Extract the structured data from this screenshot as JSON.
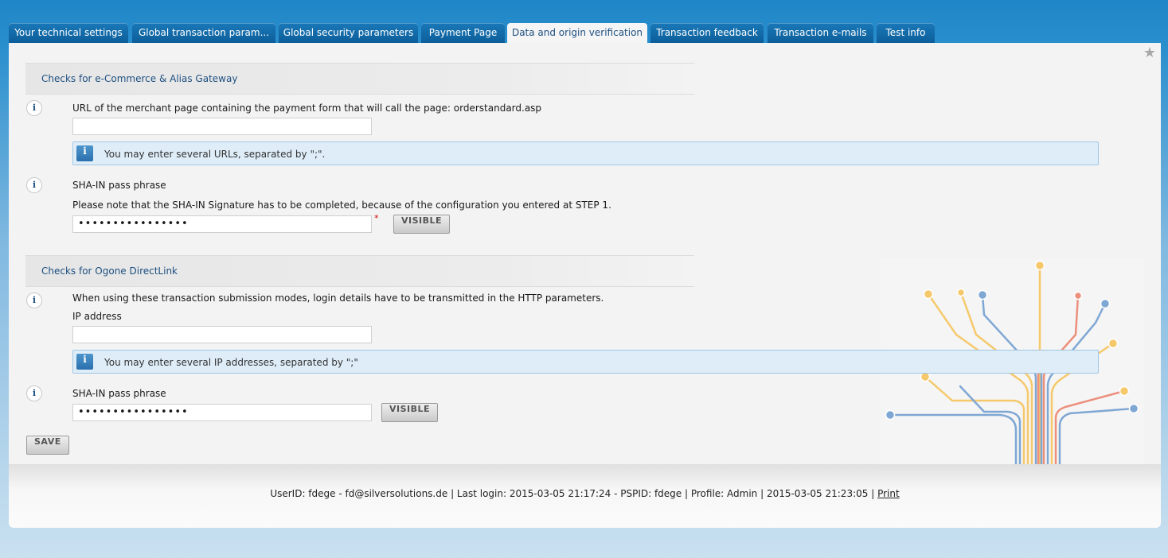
{
  "tabs": [
    {
      "label": "Your technical settings"
    },
    {
      "label": "Global transaction param..."
    },
    {
      "label": "Global security parameters"
    },
    {
      "label": "Payment Page"
    },
    {
      "label": "Data and origin verification"
    },
    {
      "label": "Transaction feedback"
    },
    {
      "label": "Transaction e-mails"
    },
    {
      "label": "Test info"
    }
  ],
  "active_tab": "Data and origin verification",
  "ecommerce": {
    "heading": "Checks for e-Commerce & Alias Gateway",
    "url_label": "URL of the merchant page containing the payment form that will call the page: orderstandard.asp",
    "url_value": "",
    "url_hint": "You may enter several URLs, separated by \";\".",
    "sha_label": "SHA-IN pass phrase",
    "sha_note": "Please note that the SHA-IN Signature has to be completed, because of the configuration you entered at STEP 1.",
    "sha_value": "••••••••••••••••",
    "required_mark": "*",
    "visible_button": "VISIBLE"
  },
  "directlink": {
    "heading": "Checks for Ogone DirectLink",
    "intro": "When using these transaction submission modes, login details have to be transmitted in the HTTP parameters.",
    "ip_label": "IP address",
    "ip_value": "",
    "ip_hint": "You may enter several IP addresses, separated by \";\"",
    "sha_label": "SHA-IN pass phrase",
    "sha_value": "••••••••••••••••",
    "visible_button": "VISIBLE"
  },
  "save_button": "SAVE",
  "info_glyph": "i",
  "footer": {
    "text": "UserID: fdege - fd@silversolutions.de | Last login: 2015-03-05 21:17:24 - PSPID: fdege | Profile: Admin | 2015-03-05 21:23:05 | ",
    "print_link": "Print"
  },
  "icons": {
    "favorite": "star-icon",
    "info": "info-icon",
    "decoration": "tree-illustration"
  },
  "colors": {
    "tab_bg": "#0c5e9a",
    "heading_text": "#1d4f80",
    "hint_bg": "#deedf8"
  }
}
